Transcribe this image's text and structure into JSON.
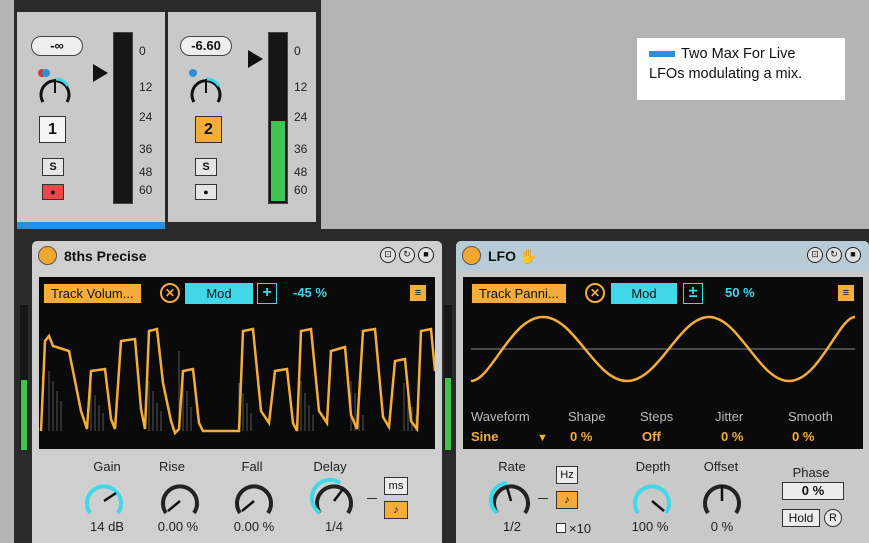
{
  "colors": {
    "accent_orange": "#f4ad3a",
    "accent_cyan": "#40d8e8",
    "meter_green": "#3fc44f",
    "selection_blue": "#2a8fd6"
  },
  "tracks": [
    {
      "volume": "-∞",
      "number": "1",
      "solo": "S",
      "scale": [
        "0",
        "12",
        "24",
        "36",
        "48",
        "60"
      ],
      "meter_level": 0
    },
    {
      "volume": "-6.60",
      "number": "2",
      "solo": "S",
      "scale": [
        "0",
        "12",
        "24",
        "36",
        "48",
        "60"
      ],
      "meter_level": 0.6
    }
  ],
  "annotation": {
    "line1": "Two Max For Live",
    "line2": "LFOs modulating a mix."
  },
  "device1": {
    "title": "8ths Precise",
    "target": "Track Volum...",
    "mode": "Mod",
    "plus": "+",
    "amount": "-45 %",
    "knobs": [
      {
        "label": "Gain",
        "value": "14 dB"
      },
      {
        "label": "Rise",
        "value": "0.00 %"
      },
      {
        "label": "Fall",
        "value": "0.00 %"
      },
      {
        "label": "Delay",
        "value": "1/4"
      }
    ],
    "ms_label": "ms"
  },
  "device2": {
    "title": "LFO",
    "target": "Track Panni...",
    "mode": "Mod",
    "plus": "±",
    "amount": "50 %",
    "params": [
      {
        "label": "Waveform",
        "value": "Sine"
      },
      {
        "label": "Shape",
        "value": "0 %"
      },
      {
        "label": "Steps",
        "value": "Off"
      },
      {
        "label": "Jitter",
        "value": "0 %"
      },
      {
        "label": "Smooth",
        "value": "0 %"
      }
    ],
    "knobs": [
      {
        "label": "Rate",
        "value": "1/2"
      },
      {
        "label": "Depth",
        "value": "100 %"
      },
      {
        "label": "Offset",
        "value": "0 %"
      }
    ],
    "hz_label": "Hz",
    "x10_label": "×10",
    "phase_label": "Phase",
    "phase_value": "0 %",
    "hold_label": "Hold",
    "r_label": "R"
  }
}
